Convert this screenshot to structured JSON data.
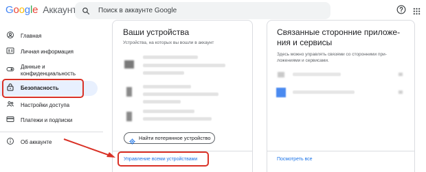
{
  "header": {
    "logo_google": "Google",
    "logo_account": "Аккаунт",
    "search_placeholder": "Поиск в аккаунте Google"
  },
  "sidebar": {
    "items": [
      {
        "label": "Главная",
        "icon": "home-icon"
      },
      {
        "label": "Личная информация",
        "icon": "id-card-icon"
      },
      {
        "label_line1": "Данные и",
        "label_line2": "конфиденциальность",
        "icon": "toggle-icon"
      },
      {
        "label": "Безопасность",
        "icon": "lock-icon",
        "active": true
      },
      {
        "label": "Настройки доступа",
        "icon": "people-icon"
      },
      {
        "label": "Платежи и подписки",
        "icon": "credit-card-icon"
      }
    ],
    "about": {
      "label": "Об аккаунте",
      "icon": "info-icon"
    }
  },
  "devices_card": {
    "title": "Ваши устройства",
    "description": "Устройства, на которых вы вошли в аккаунт",
    "find_button": "Найти потерянное устройство",
    "manage_link": "Управление всеми устройствами"
  },
  "connections_card": {
    "title_line1": "Связанные сторонние приложе-",
    "title_line2": "ния и сервисы",
    "desc_line1": "Здесь можно управлять связями со сторонними при-",
    "desc_line2": "ложениями и сервисами.",
    "see_all_link": "Посмотреть все"
  },
  "colors": {
    "accent_blue": "#1a73e8",
    "highlight_red": "#d93025",
    "active_bg": "#e8f0fe"
  }
}
